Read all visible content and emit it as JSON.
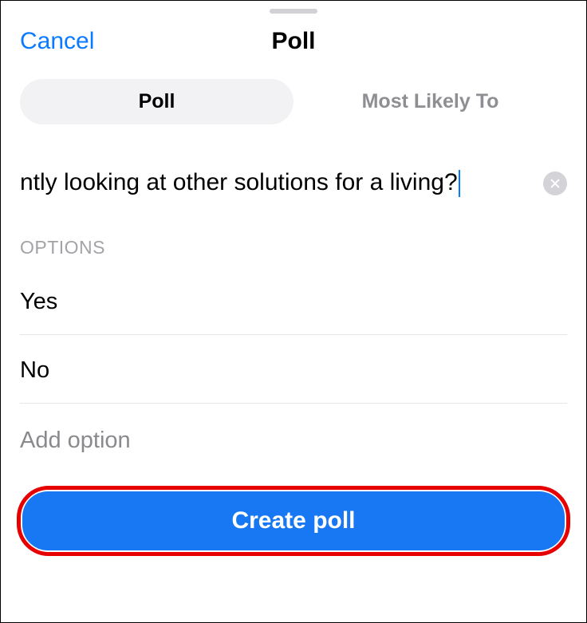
{
  "header": {
    "cancel": "Cancel",
    "title": "Poll"
  },
  "tabs": {
    "poll": "Poll",
    "mostLikely": "Most Likely To"
  },
  "question": {
    "value": "ntly looking at other solutions for a living?"
  },
  "optionsLabel": "OPTIONS",
  "options": [
    "Yes",
    "No"
  ],
  "addOptionPlaceholder": "Add option",
  "createButton": "Create poll"
}
